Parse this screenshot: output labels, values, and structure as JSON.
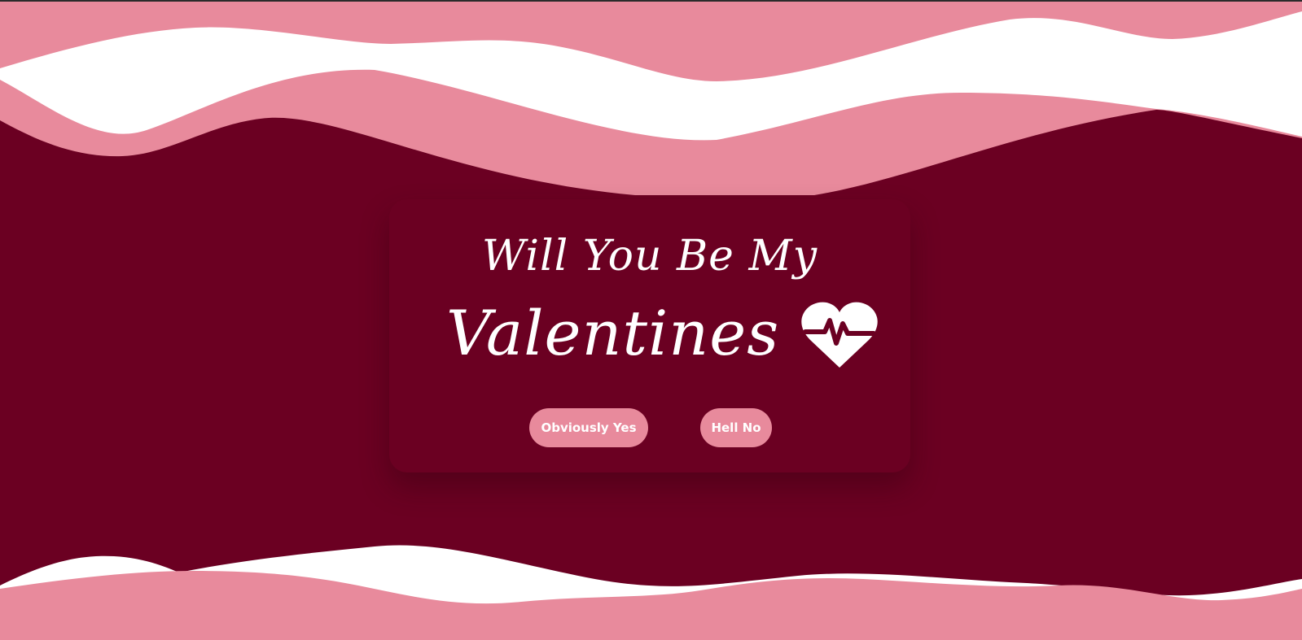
{
  "heading": {
    "line1": "Will You Be My",
    "line2": "Valentines"
  },
  "icons": {
    "heart": "heart-pulse-icon"
  },
  "buttons": {
    "yes_label": "Obviously Yes",
    "no_label": "Hell No"
  },
  "colors": {
    "background": "#6b0022",
    "wave_pink": "#e88a9c",
    "wave_white": "#ffffff",
    "text": "#ffffff"
  }
}
